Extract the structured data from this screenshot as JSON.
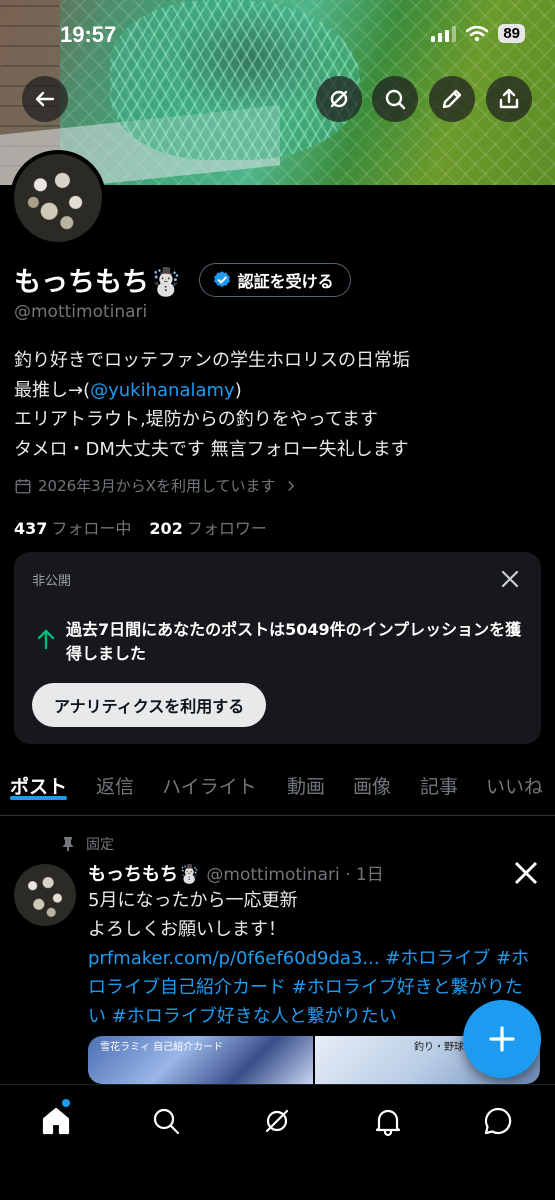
{
  "status_bar": {
    "time": "19:57",
    "battery": "89"
  },
  "profile": {
    "display_name": "もっちもち☃️",
    "verify_button": "認証を受ける",
    "handle": "@mottimotinari",
    "bio_line1": "釣り好きでロッテファンの学生ホロリスの日常垢",
    "bio_line2_prefix": "最推し→(",
    "bio_line2_link": "@yukihanalamy",
    "bio_line2_suffix": ")",
    "bio_line3": "エリアトラウト,堤防からの釣りをやってます",
    "bio_line4": "タメロ・DM大丈夫です 無言フォロー失礼します",
    "joined": "2026年3月からXを利用しています",
    "following_count": "437",
    "following_label": "フォロー中",
    "followers_count": "202",
    "followers_label": "フォロワー"
  },
  "private_card": {
    "label": "非公開",
    "text": "過去7日間にあなたのポストは5049件のインプレッションを獲得しました",
    "button": "アナリティクスを利用する"
  },
  "tabs": [
    "ポスト",
    "返信",
    "ハイライト",
    "動画",
    "画像",
    "記事",
    "いいね"
  ],
  "pinned_tweet": {
    "pinned_label": "固定",
    "name": "もっちもち☃️",
    "handle_time": "@mottimotinari · 1日",
    "line1": "5月になったから一応更新",
    "line2_text": "よろしくお願いします！",
    "link1": "prfmaker.com/p/0f6ef60d9da3...",
    "hashtags": "#ホロライブ #ホロライブ自己紹介カード #ホロライブ好きと繋がりたい #ホロライブ好きな人と繋がりたい",
    "media_label1": "雪花ラミィ 自己紹介カード",
    "media_label2": "釣り・野球"
  },
  "icons": {
    "back": "arrow-left-icon",
    "grok": "grok-icon",
    "search": "search-icon",
    "edit": "pencil-icon",
    "share": "share-icon",
    "home": "home-icon",
    "notifications": "bell-icon",
    "messages": "message-icon",
    "compose": "plus-icon"
  },
  "colors": {
    "accent": "#1d9bf0",
    "background": "#000000",
    "success": "#00ba7c"
  }
}
